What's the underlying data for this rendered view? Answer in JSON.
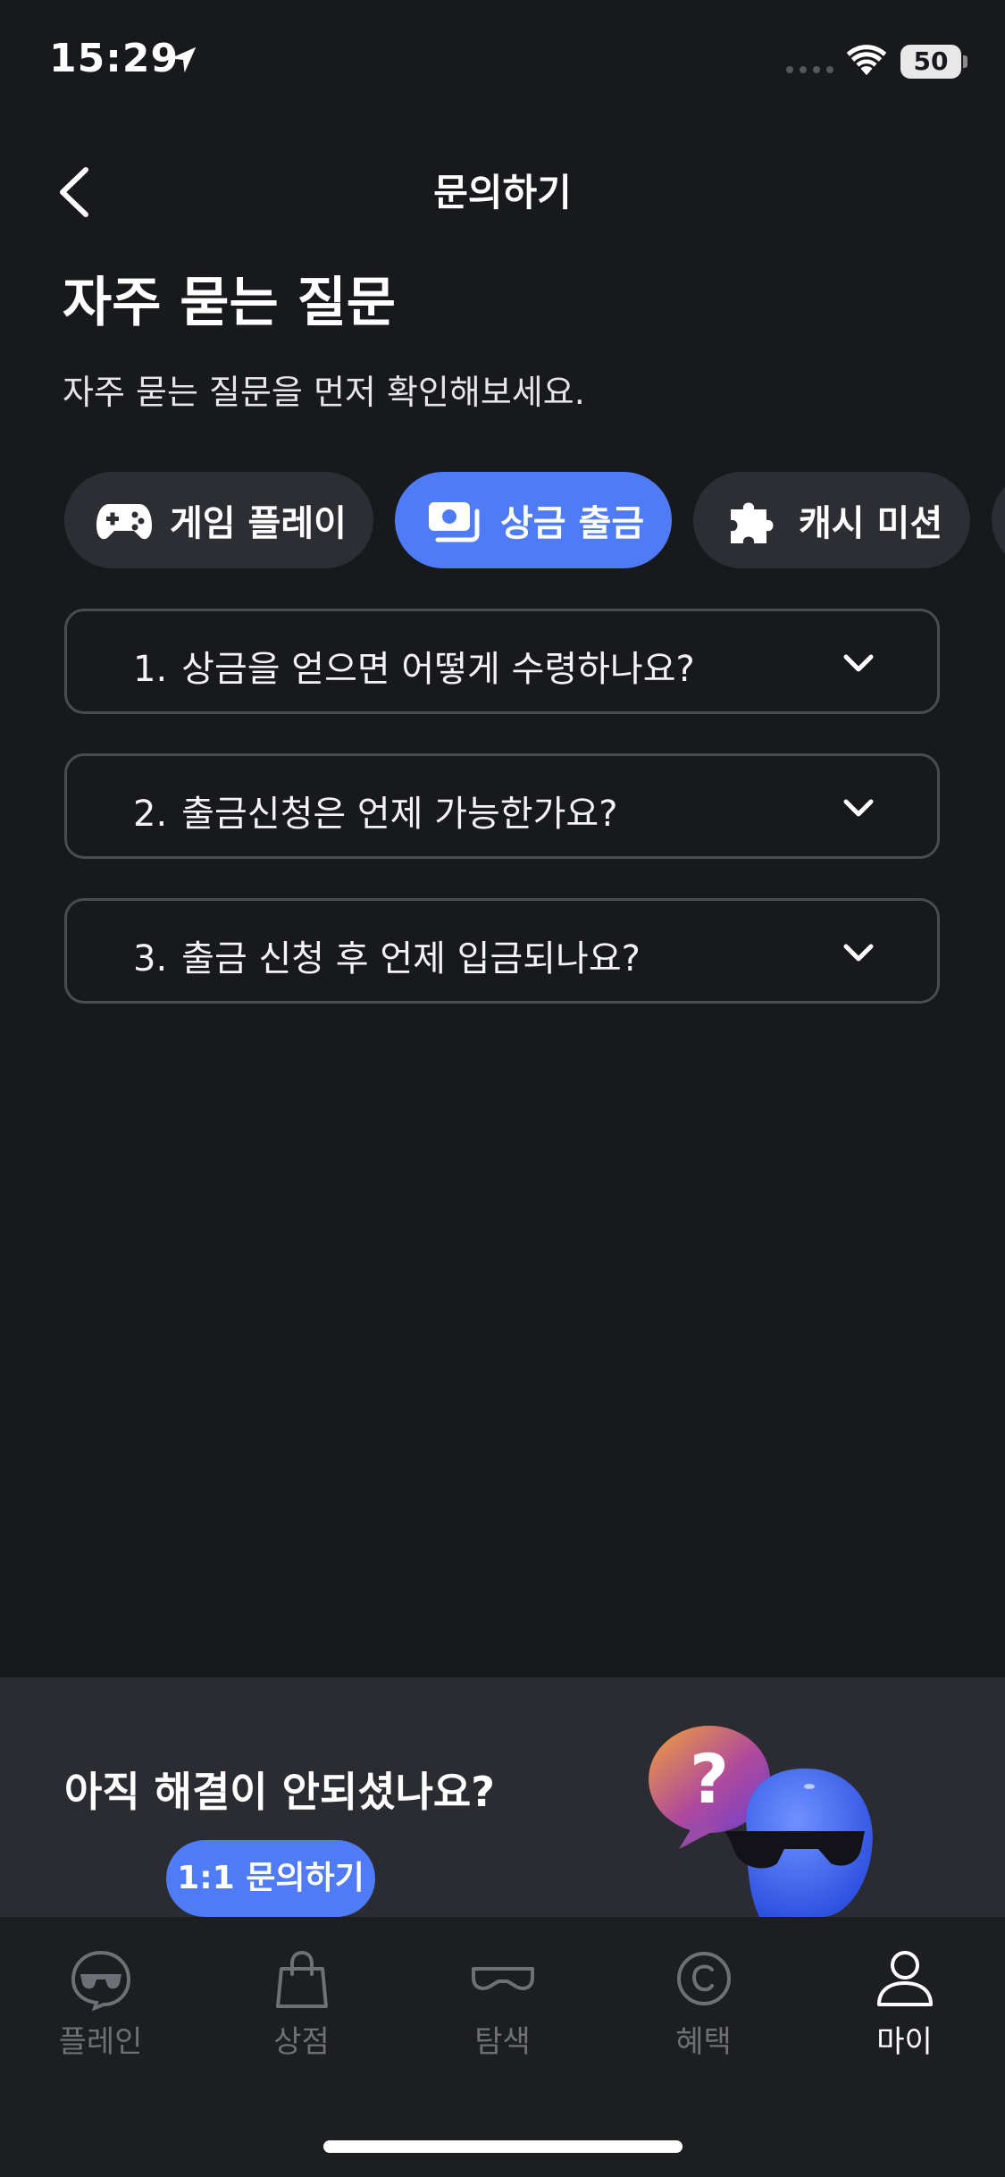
{
  "status_bar": {
    "time": "15:29",
    "battery": "50"
  },
  "header": {
    "title": "문의하기"
  },
  "page": {
    "title": "자주 묻는 질문",
    "subtitle": "자주 묻는 질문을 먼저 확인해보세요."
  },
  "categories": [
    {
      "label": "게임 플레이",
      "icon": "gamepad-icon",
      "active": false
    },
    {
      "label": "상금 출금",
      "icon": "cash-icon",
      "active": true
    },
    {
      "label": "캐시 미션",
      "icon": "puzzle-icon",
      "active": false
    }
  ],
  "faq": [
    {
      "num": "1.",
      "question": "상금을 얻으면 어떻게 수령하나요?"
    },
    {
      "num": "2.",
      "question": "출금신청은 언제 가능한가요?"
    },
    {
      "num": "3.",
      "question": "출금 신청 후 언제 입금되나요?"
    }
  ],
  "help": {
    "title": "아직 해결이 안되셨나요?",
    "button_label": "1:1 문의하기"
  },
  "tabs": [
    {
      "label": "플레인",
      "icon": "play-icon",
      "active": false
    },
    {
      "label": "상점",
      "icon": "shop-bag-icon",
      "active": false
    },
    {
      "label": "탐색",
      "icon": "explore-icon",
      "active": false
    },
    {
      "label": "혜택",
      "icon": "coin-icon",
      "active": false
    },
    {
      "label": "마이",
      "icon": "profile-icon",
      "active": true
    }
  ],
  "colors": {
    "background": "#18191c",
    "accent": "#4f7bf7",
    "chip": "#2c2e33",
    "banner": "#2a2c32",
    "tabbar": "#1d1e22"
  }
}
